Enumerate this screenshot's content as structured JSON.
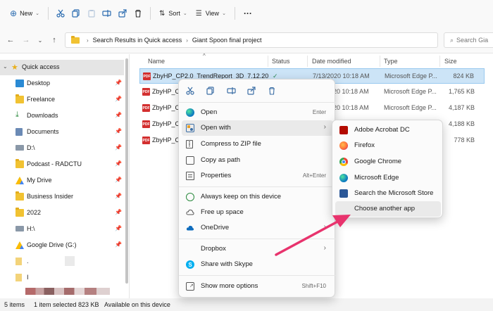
{
  "toolbar": {
    "new_label": "New",
    "sort_label": "Sort",
    "view_label": "View",
    "more_label": "···"
  },
  "address": {
    "crumbs": [
      "Search Results in Quick access",
      "Giant Spoon final project"
    ],
    "search_placeholder": "Search Gia"
  },
  "sidebar": {
    "items": [
      {
        "label": "Quick access",
        "icon": "star-icon",
        "pinned": false
      },
      {
        "label": "Desktop",
        "icon": "desktop-icon",
        "pinned": true
      },
      {
        "label": "Freelance",
        "icon": "folder-icon",
        "pinned": true
      },
      {
        "label": "Downloads",
        "icon": "download-icon",
        "pinned": true
      },
      {
        "label": "Documents",
        "icon": "document-icon",
        "pinned": true
      },
      {
        "label": "D:\\",
        "icon": "drive-icon",
        "pinned": true
      },
      {
        "label": "Podcast -  RADCTU",
        "icon": "folder-icon",
        "pinned": true
      },
      {
        "label": "My Drive",
        "icon": "google-drive-icon",
        "pinned": true
      },
      {
        "label": "Business Insider",
        "icon": "folder-icon",
        "pinned": true
      },
      {
        "label": "2022",
        "icon": "folder-icon",
        "pinned": true
      },
      {
        "label": "H:\\",
        "icon": "drive-icon",
        "pinned": true
      },
      {
        "label": "Google Drive (G:)",
        "icon": "google-drive-icon",
        "pinned": true
      },
      {
        "label": ".",
        "icon": "file-icon",
        "pinned": false
      },
      {
        "label": "I",
        "icon": "file-icon",
        "pinned": false
      }
    ]
  },
  "columns": {
    "name": "Name",
    "status": "Status",
    "date": "Date modified",
    "type": "Type",
    "size": "Size"
  },
  "files": [
    {
      "name": "ZbyHP_CP2.0_TrendReport_3D_7.12.20",
      "date": "7/13/2020 10:18 AM",
      "type": "Microsoft Edge P...",
      "size": "824 KB"
    },
    {
      "name": "ZbyHP_CP",
      "date": "7/13/2020 10:18 AM",
      "type": "Microsoft Edge P...",
      "size": "1,765 KB"
    },
    {
      "name": "ZbyHP_CP",
      "date": "7/13/2020 10:18 AM",
      "type": "Microsoft Edge P...",
      "size": "4,187 KB"
    },
    {
      "name": "ZbyHP_CP",
      "date": "",
      "type": "",
      "size": "4,188 KB"
    },
    {
      "name": "ZbyHP_CP",
      "date": "",
      "type": "",
      "size": "778 KB"
    }
  ],
  "status_bar": {
    "items": "5 items",
    "selected": "1 item selected  823 KB",
    "available": "Available on this device"
  },
  "context_menu": {
    "items": [
      {
        "label": "Open",
        "shortcut": "Enter",
        "icon": "edge-icon"
      },
      {
        "label": "Open with",
        "shortcut": "",
        "icon": "open-with-icon",
        "submenu": true
      },
      {
        "label": "Compress to ZIP file",
        "shortcut": "",
        "icon": "zip-icon"
      },
      {
        "label": "Copy as path",
        "shortcut": "",
        "icon": "copy-path-icon"
      },
      {
        "label": "Properties",
        "shortcut": "Alt+Enter",
        "icon": "properties-icon"
      },
      {
        "label": "Always keep on this device",
        "shortcut": "",
        "icon": "cloud-sync-icon"
      },
      {
        "label": "Free up space",
        "shortcut": "",
        "icon": "cloud-icon"
      },
      {
        "label": "OneDrive",
        "shortcut": "",
        "icon": "onedrive-icon",
        "submenu": true
      },
      {
        "label": "Dropbox",
        "shortcut": "",
        "icon": "dropbox-icon",
        "submenu": true
      },
      {
        "label": "Share with Skype",
        "shortcut": "",
        "icon": "skype-icon"
      },
      {
        "label": "Show more options",
        "shortcut": "Shift+F10",
        "icon": "more-options-icon"
      }
    ]
  },
  "open_with_menu": {
    "items": [
      {
        "label": "Adobe Acrobat DC",
        "icon": "acrobat-icon",
        "color": "#b30b00"
      },
      {
        "label": "Firefox",
        "icon": "firefox-icon",
        "color": "#ff7139"
      },
      {
        "label": "Google Chrome",
        "icon": "chrome-icon",
        "color": "#34a853"
      },
      {
        "label": "Microsoft Edge",
        "icon": "edge-icon",
        "color": "#0c7ac0"
      },
      {
        "label": "Search the Microsoft Store",
        "icon": "store-icon",
        "color": "#2b5797"
      },
      {
        "label": "Choose another app",
        "icon": "",
        "color": ""
      }
    ]
  },
  "annotation": {
    "arrow_color": "#e8336d"
  }
}
